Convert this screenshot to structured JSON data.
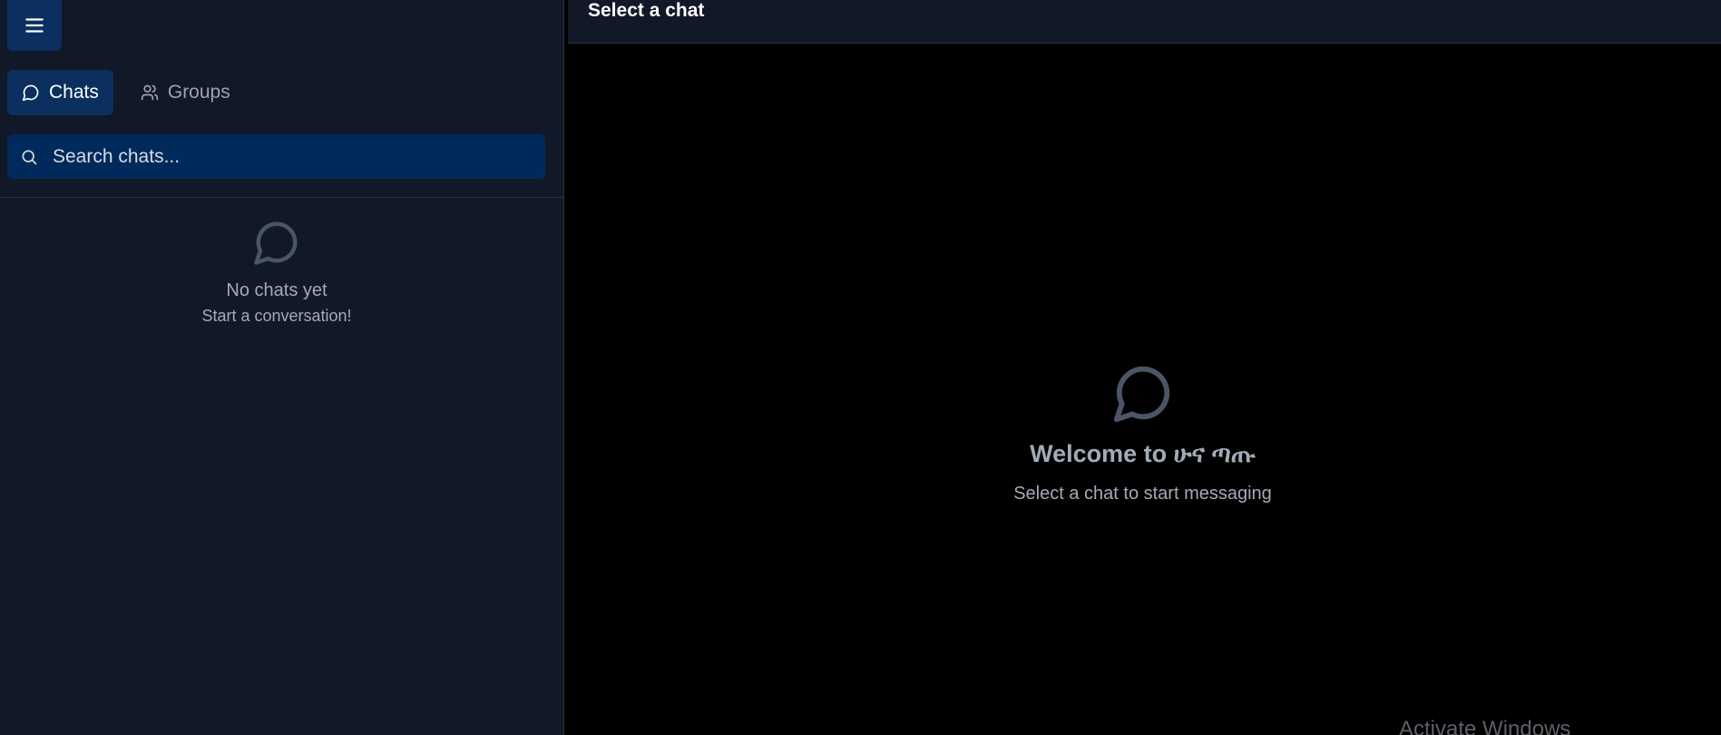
{
  "sidebar": {
    "menu_icon": "hamburger-icon",
    "tabs": [
      {
        "label": "Chats",
        "icon": "chat-bubble-icon",
        "active": true
      },
      {
        "label": "Groups",
        "icon": "users-icon",
        "active": false
      }
    ],
    "search": {
      "placeholder": "Search chats...",
      "value": "",
      "icon": "search-icon"
    },
    "empty_state": {
      "icon": "chat-bubble-icon",
      "title": "No chats yet",
      "subtitle": "Start a conversation!"
    }
  },
  "main": {
    "header_title": "Select a chat",
    "welcome": {
      "icon": "chat-bubble-icon",
      "title": "Welcome to ሁና ጣጡ",
      "subtitle": "Select a chat to start messaging"
    }
  },
  "os_watermark": "Activate Windows",
  "colors": {
    "sidebar_bg": "#111827",
    "accent": "#0b2f5e",
    "search_bg": "#002a5c",
    "main_bg": "#000000",
    "muted_text": "#a3abb8",
    "icon_gray": "#4b5563"
  }
}
